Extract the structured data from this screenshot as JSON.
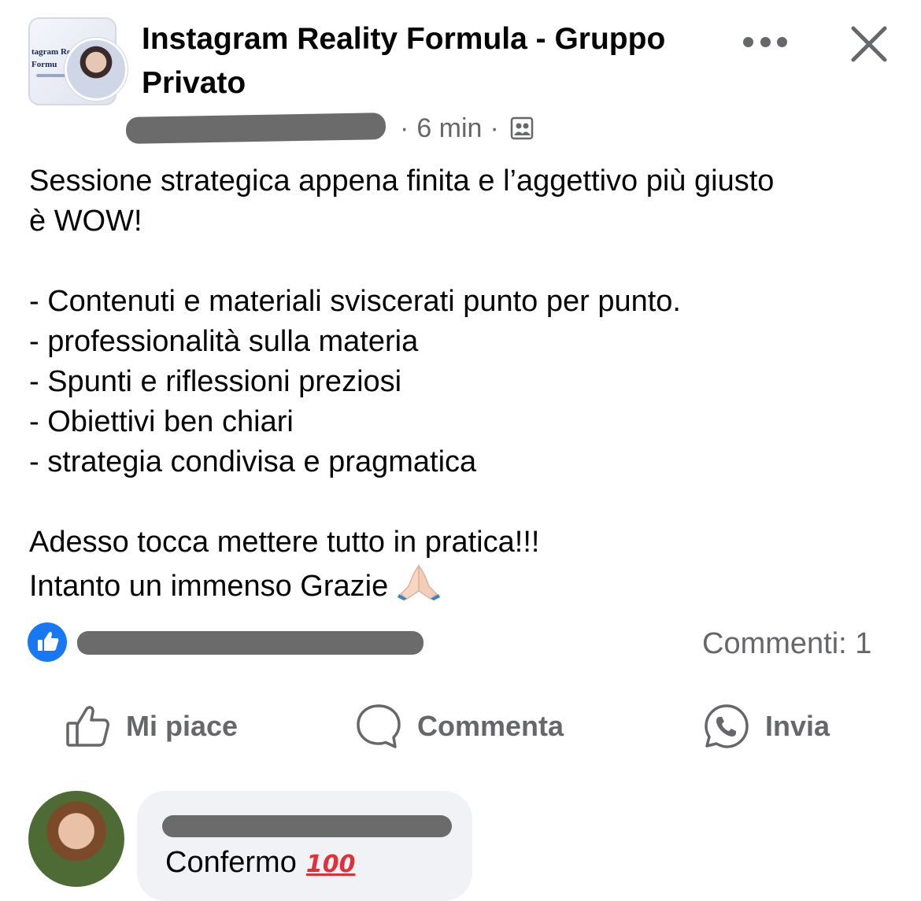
{
  "header": {
    "group_title": "Instagram Reality Formula - Gruppo Privato",
    "group_thumb_text": "tagram Re\nFormu",
    "timestamp": "6 min"
  },
  "post": {
    "intro": [
      "Sessione strategica appena finita e l’aggettivo più giusto",
      "è WOW!"
    ],
    "bullets": [
      "- Contenuti e materiali sviscerati punto per punto.",
      "- professionalità sulla materia",
      "- Spunti e riflessioni preziosi",
      "- Obiettivi ben chiari",
      "- strategia condivisa e pragmatica"
    ],
    "outro_line1": "Adesso tocca mettere tutto in pratica!!!",
    "outro_line2": "Intanto un immenso Grazie"
  },
  "reactions": {
    "comments_label": "Commenti: 1"
  },
  "actions": {
    "like_label": "Mi piace",
    "comment_label": "Commenta",
    "send_label": "Invia"
  },
  "comment": {
    "text": "Confermo",
    "emoji_text": "100"
  },
  "icons": {
    "more": "more-dots-icon",
    "close": "close-icon",
    "group": "group-privacy-icon",
    "like_badge": "like-reaction-icon",
    "like": "thumbs-up-icon",
    "comment": "comment-bubble-icon",
    "send": "whatsapp-icon",
    "pray": "folded-hands-icon",
    "hundred": "hundred-points-icon"
  },
  "colors": {
    "accent": "#1877f2",
    "secondary_text": "#65676b",
    "bubble": "#f0f2f5"
  }
}
